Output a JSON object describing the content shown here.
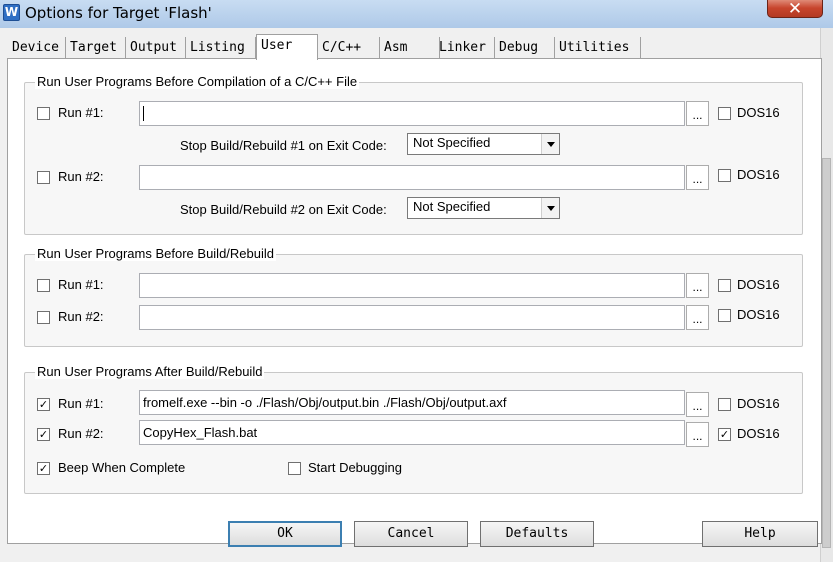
{
  "window": {
    "title": "Options for Target 'Flash'",
    "icon_glyph": "W",
    "close_glyph": "✕"
  },
  "tabs": [
    {
      "label": "Device"
    },
    {
      "label": "Target"
    },
    {
      "label": "Output"
    },
    {
      "label": "Listing"
    },
    {
      "label": "User",
      "active": true
    },
    {
      "label": "C/C++"
    },
    {
      "label": "Asm"
    },
    {
      "label": "Linker"
    },
    {
      "label": "Debug"
    },
    {
      "label": "Utilities"
    }
  ],
  "before_compile": {
    "title": "Run User Programs Before Compilation of a C/C++ File",
    "run1": {
      "label": "Run #1:",
      "checked": false,
      "value": "",
      "dos16_label": "DOS16",
      "dos16_checked": false
    },
    "stop1": {
      "label": "Stop Build/Rebuild #1 on Exit Code:",
      "value": "Not Specified"
    },
    "run2": {
      "label": "Run #2:",
      "checked": false,
      "value": "",
      "dos16_label": "DOS16",
      "dos16_checked": false
    },
    "stop2": {
      "label": "Stop Build/Rebuild #2 on Exit Code:",
      "value": "Not Specified"
    }
  },
  "before_build": {
    "title": "Run User Programs Before Build/Rebuild",
    "run1": {
      "label": "Run #1:",
      "checked": false,
      "value": "",
      "dos16_label": "DOS16",
      "dos16_checked": false
    },
    "run2": {
      "label": "Run #2:",
      "checked": false,
      "value": "",
      "dos16_label": "DOS16",
      "dos16_checked": false
    }
  },
  "after_build": {
    "title": "Run User Programs After Build/Rebuild",
    "run1": {
      "label": "Run #1:",
      "checked": true,
      "value": "fromelf.exe --bin -o  ./Flash/Obj/output.bin  ./Flash/Obj/output.axf",
      "dos16_label": "DOS16",
      "dos16_checked": false
    },
    "run2": {
      "label": "Run #2:",
      "checked": true,
      "value": "CopyHex_Flash.bat",
      "dos16_label": "DOS16",
      "dos16_checked": true
    },
    "beep": {
      "label": "Beep When Complete",
      "checked": true
    },
    "start_debugging": {
      "label": "Start Debugging",
      "checked": false
    }
  },
  "browse_label": "...",
  "check_glyph": "✓",
  "buttons": {
    "ok": "OK",
    "cancel": "Cancel",
    "defaults": "Defaults",
    "help": "Help"
  }
}
